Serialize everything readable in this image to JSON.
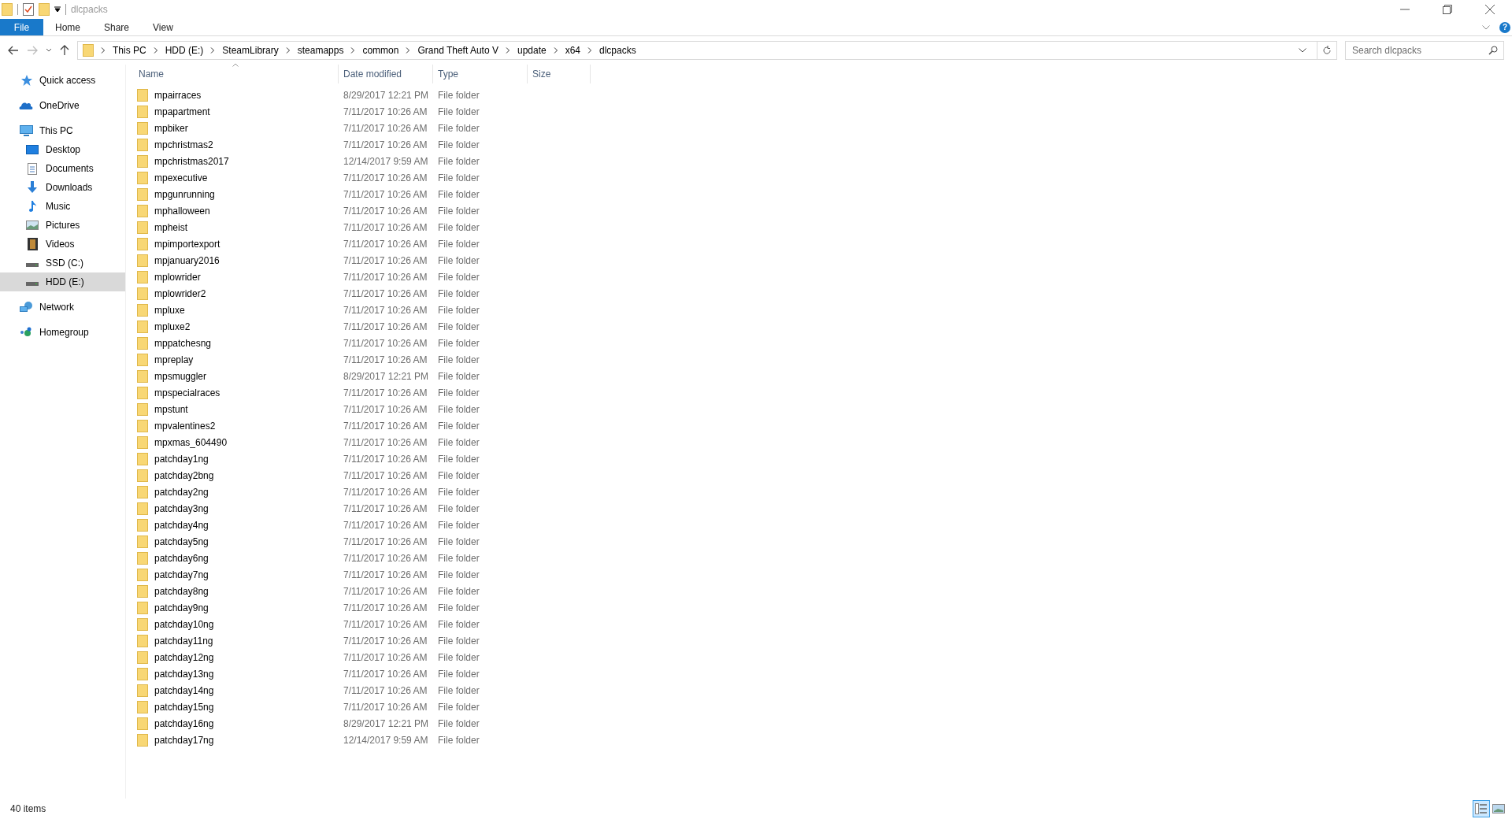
{
  "window": {
    "title": "dlcpacks"
  },
  "ribbon_tabs": [
    {
      "label": "File",
      "kind": "file"
    },
    {
      "label": "Home",
      "kind": "tab"
    },
    {
      "label": "Share",
      "kind": "tab"
    },
    {
      "label": "View",
      "kind": "tab"
    }
  ],
  "help_button": "?",
  "address_bar": {
    "segments": [
      "This PC",
      "HDD (E:)",
      "SteamLibrary",
      "steamapps",
      "common",
      "Grand Theft Auto V",
      "update",
      "x64",
      "dlcpacks"
    ]
  },
  "search": {
    "placeholder": "Search dlcpacks"
  },
  "sidebar": {
    "items": [
      {
        "label": "Quick access",
        "kind": "star",
        "selected": false
      },
      {
        "label": "OneDrive",
        "kind": "cloud",
        "selected": false
      },
      {
        "label": "This PC",
        "kind": "pc",
        "selected": false,
        "children": [
          {
            "label": "Desktop",
            "kind": "desktop",
            "selected": false
          },
          {
            "label": "Documents",
            "kind": "document",
            "selected": false
          },
          {
            "label": "Downloads",
            "kind": "download",
            "selected": false
          },
          {
            "label": "Music",
            "kind": "music",
            "selected": false
          },
          {
            "label": "Pictures",
            "kind": "picture",
            "selected": false
          },
          {
            "label": "Videos",
            "kind": "video",
            "selected": false
          },
          {
            "label": "SSD (C:)",
            "kind": "drive",
            "selected": false
          },
          {
            "label": "HDD (E:)",
            "kind": "drive",
            "selected": true
          }
        ]
      },
      {
        "label": "Network",
        "kind": "network",
        "selected": false
      },
      {
        "label": "Homegroup",
        "kind": "homegroup",
        "selected": false
      }
    ]
  },
  "table": {
    "columns": [
      "Name",
      "Date modified",
      "Type",
      "Size"
    ],
    "rows": [
      [
        "mpairraces",
        "8/29/2017 12:21 PM",
        "File folder"
      ],
      [
        "mpapartment",
        "7/11/2017 10:26 AM",
        "File folder"
      ],
      [
        "mpbiker",
        "7/11/2017 10:26 AM",
        "File folder"
      ],
      [
        "mpchristmas2",
        "7/11/2017 10:26 AM",
        "File folder"
      ],
      [
        "mpchristmas2017",
        "12/14/2017 9:59 AM",
        "File folder"
      ],
      [
        "mpexecutive",
        "7/11/2017 10:26 AM",
        "File folder"
      ],
      [
        "mpgunrunning",
        "7/11/2017 10:26 AM",
        "File folder"
      ],
      [
        "mphalloween",
        "7/11/2017 10:26 AM",
        "File folder"
      ],
      [
        "mpheist",
        "7/11/2017 10:26 AM",
        "File folder"
      ],
      [
        "mpimportexport",
        "7/11/2017 10:26 AM",
        "File folder"
      ],
      [
        "mpjanuary2016",
        "7/11/2017 10:26 AM",
        "File folder"
      ],
      [
        "mplowrider",
        "7/11/2017 10:26 AM",
        "File folder"
      ],
      [
        "mplowrider2",
        "7/11/2017 10:26 AM",
        "File folder"
      ],
      [
        "mpluxe",
        "7/11/2017 10:26 AM",
        "File folder"
      ],
      [
        "mpluxe2",
        "7/11/2017 10:26 AM",
        "File folder"
      ],
      [
        "mppatchesng",
        "7/11/2017 10:26 AM",
        "File folder"
      ],
      [
        "mpreplay",
        "7/11/2017 10:26 AM",
        "File folder"
      ],
      [
        "mpsmuggler",
        "8/29/2017 12:21 PM",
        "File folder"
      ],
      [
        "mpspecialraces",
        "7/11/2017 10:26 AM",
        "File folder"
      ],
      [
        "mpstunt",
        "7/11/2017 10:26 AM",
        "File folder"
      ],
      [
        "mpvalentines2",
        "7/11/2017 10:26 AM",
        "File folder"
      ],
      [
        "mpxmas_604490",
        "7/11/2017 10:26 AM",
        "File folder"
      ],
      [
        "patchday1ng",
        "7/11/2017 10:26 AM",
        "File folder"
      ],
      [
        "patchday2bng",
        "7/11/2017 10:26 AM",
        "File folder"
      ],
      [
        "patchday2ng",
        "7/11/2017 10:26 AM",
        "File folder"
      ],
      [
        "patchday3ng",
        "7/11/2017 10:26 AM",
        "File folder"
      ],
      [
        "patchday4ng",
        "7/11/2017 10:26 AM",
        "File folder"
      ],
      [
        "patchday5ng",
        "7/11/2017 10:26 AM",
        "File folder"
      ],
      [
        "patchday6ng",
        "7/11/2017 10:26 AM",
        "File folder"
      ],
      [
        "patchday7ng",
        "7/11/2017 10:26 AM",
        "File folder"
      ],
      [
        "patchday8ng",
        "7/11/2017 10:26 AM",
        "File folder"
      ],
      [
        "patchday9ng",
        "7/11/2017 10:26 AM",
        "File folder"
      ],
      [
        "patchday10ng",
        "7/11/2017 10:26 AM",
        "File folder"
      ],
      [
        "patchday11ng",
        "7/11/2017 10:26 AM",
        "File folder"
      ],
      [
        "patchday12ng",
        "7/11/2017 10:26 AM",
        "File folder"
      ],
      [
        "patchday13ng",
        "7/11/2017 10:26 AM",
        "File folder"
      ],
      [
        "patchday14ng",
        "7/11/2017 10:26 AM",
        "File folder"
      ],
      [
        "patchday15ng",
        "7/11/2017 10:26 AM",
        "File folder"
      ],
      [
        "patchday16ng",
        "8/29/2017 12:21 PM",
        "File folder"
      ],
      [
        "patchday17ng",
        "12/14/2017 9:59 AM",
        "File folder"
      ]
    ]
  },
  "status_bar": {
    "item_count": "40 items"
  },
  "view_buttons": [
    {
      "kind": "details",
      "selected": true
    },
    {
      "kind": "large_icons",
      "selected": false
    }
  ]
}
